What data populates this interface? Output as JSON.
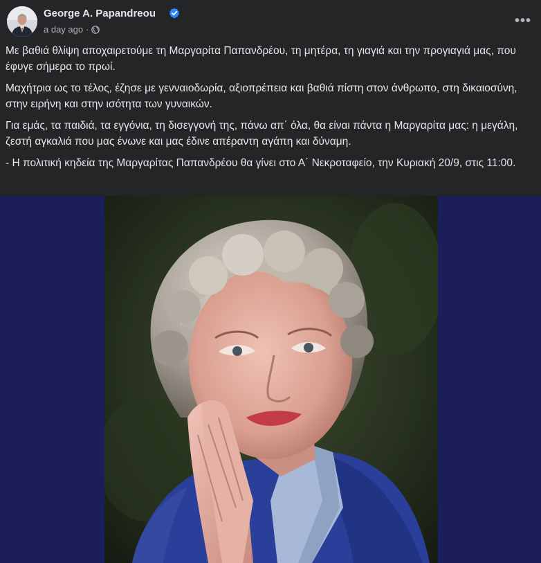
{
  "post": {
    "author": {
      "name": "George A. Papandreou",
      "verified": true
    },
    "time": "a day ago",
    "separator": "·",
    "privacy_icon": "globe-icon",
    "more_icon": "more-horizontal-icon",
    "more_label": "•••",
    "paragraphs": [
      "Με βαθιά θλίψη αποχαιρετούμε τη Μαργαρίτα Παπανδρέου, τη μητέρα, τη γιαγιά και την προγιαγιά μας, που έφυγε σήμερα το πρωί.",
      "Μαχήτρια ως το τέλος, έζησε με γενναιοδωρία, αξιοπρέπεια και βαθιά πίστη στον άνθρωπο, στη δικαιοσύνη, στην ειρήνη και στην ισότητα των γυναικών.",
      "Για εμάς, τα παιδιά, τα εγγόνια, τη δισεγγονή της, πάνω απ΄ όλα, θα είναι πάντα η Μαργαρίτα μας: η μεγάλη, ζεστή αγκαλιά που μας ένωνε και μας έδινε απέραντη αγάπη και δύναμη.",
      "- Η πολιτική κηδεία της Μαργαρίτας Παπανδρέου θα γίνει στο Α΄ Νεκροταφείο, την Κυριακή 20/9, στις 11:00."
    ],
    "photo": {
      "background_color": "#1c1e5c"
    }
  },
  "colors": {
    "card_bg": "#242526",
    "text_primary": "#e4e6eb",
    "text_secondary": "#b0b3b8",
    "verified_blue": "#2d88ff"
  }
}
